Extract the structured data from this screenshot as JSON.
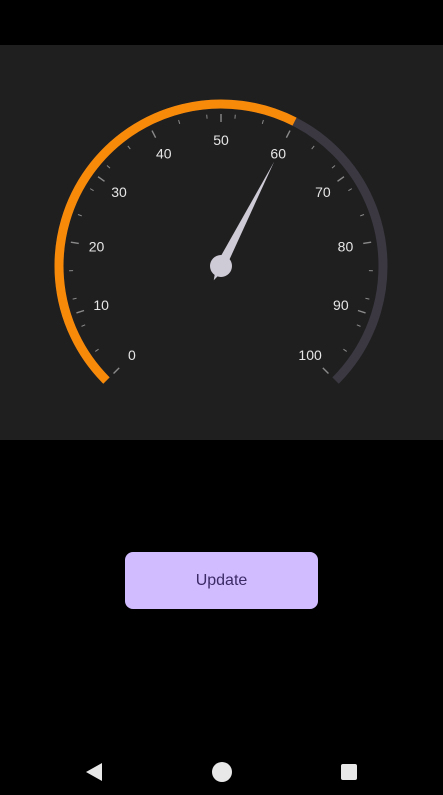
{
  "gauge": {
    "min": 0,
    "max": 100,
    "value": 60,
    "tick_labels": [
      "0",
      "10",
      "20",
      "30",
      "40",
      "50",
      "60",
      "70",
      "80",
      "90",
      "100"
    ],
    "progress_color": "#f88a0a",
    "track_color": "#3b3842",
    "needle_color": "#cfcbd6",
    "panel_color": "#1f1f1f"
  },
  "button": {
    "label": "Update",
    "color": "#d0bcff"
  },
  "nav": {
    "back_icon": "back-triangle-icon",
    "home_icon": "home-circle-icon",
    "recent_icon": "recent-apps-square-icon"
  }
}
